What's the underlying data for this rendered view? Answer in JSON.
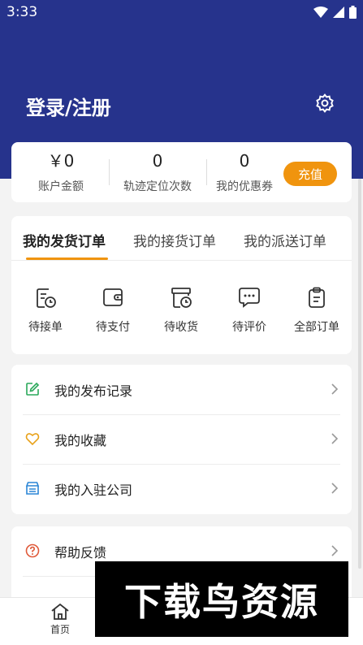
{
  "status_bar": {
    "time": "3:33"
  },
  "header": {
    "title": "登录/注册",
    "settings_icon": "gear-icon",
    "bg_color": "#26338c"
  },
  "stats": {
    "balance": {
      "value": "￥0",
      "label": "账户金额"
    },
    "tracking": {
      "value": "0",
      "label": "轨迹定位次数"
    },
    "coupons": {
      "value": "0",
      "label": "我的优惠券"
    },
    "recharge_label": "充值",
    "accent_color": "#f0940e"
  },
  "orders": {
    "tabs": [
      "我的发货订单",
      "我的接货订单",
      "我的派送订单"
    ],
    "items": [
      {
        "label": "待接单",
        "icon": "pending-accept-icon"
      },
      {
        "label": "待支付",
        "icon": "wallet-icon"
      },
      {
        "label": "待收货",
        "icon": "pending-receipt-icon"
      },
      {
        "label": "待评价",
        "icon": "chat-icon"
      },
      {
        "label": "全部订单",
        "icon": "clipboard-icon"
      }
    ]
  },
  "menu": [
    {
      "label": "我的发布记录",
      "icon": "edit-icon"
    },
    {
      "label": "我的收藏",
      "icon": "heart-icon"
    },
    {
      "label": "我的入驻公司",
      "icon": "store-icon"
    }
  ],
  "menu2": [
    {
      "label": "帮助反馈",
      "icon": "help-icon"
    }
  ],
  "bottom_nav": {
    "home_label": "首页"
  },
  "watermark": {
    "text": "下载鸟资源"
  }
}
